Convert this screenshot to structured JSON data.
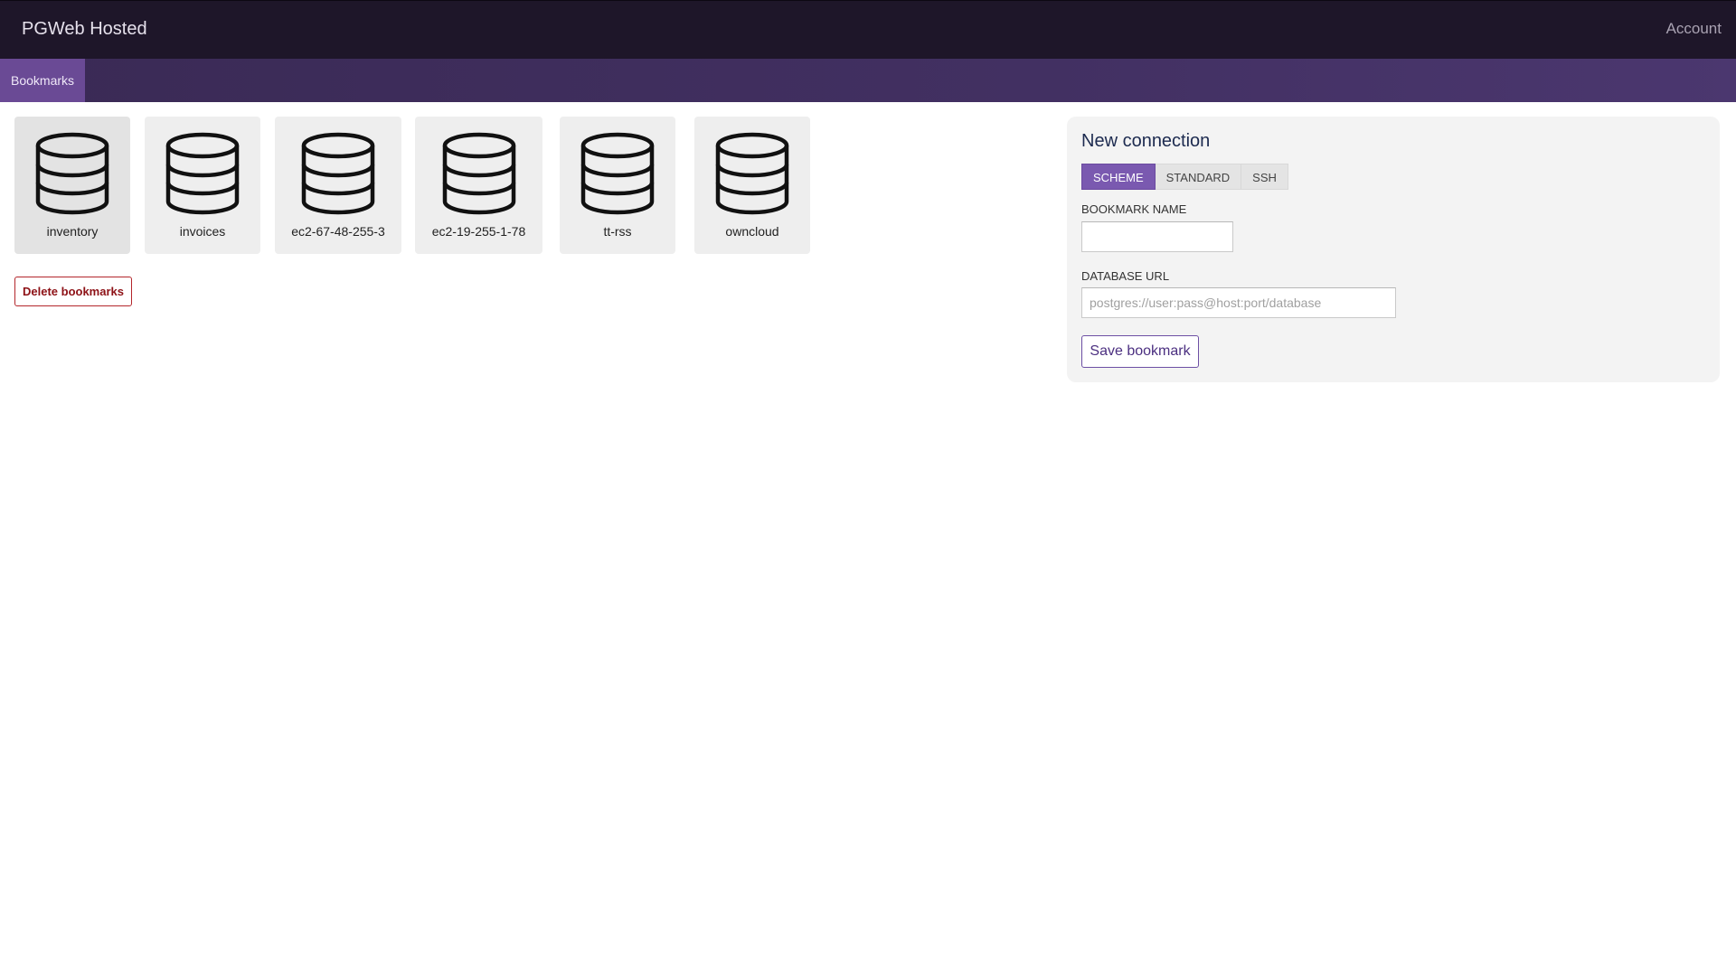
{
  "app": {
    "title": "PGWeb Hosted",
    "account_label": "Account"
  },
  "nav": {
    "tabs": [
      {
        "label": "Bookmarks",
        "active": true
      }
    ]
  },
  "bookmarks": {
    "items": [
      {
        "name": "inventory",
        "icon": "database-icon",
        "selected": true
      },
      {
        "name": "invoices",
        "icon": "database-icon",
        "selected": false
      },
      {
        "name": "ec2-67-48-255-3",
        "icon": "database-icon",
        "selected": false
      },
      {
        "name": "ec2-19-255-1-78",
        "icon": "database-icon",
        "selected": false
      },
      {
        "name": "tt-rss",
        "icon": "database-icon",
        "selected": false
      },
      {
        "name": "owncloud",
        "icon": "database-icon",
        "selected": false
      }
    ],
    "delete_label": "Delete bookmarks"
  },
  "connection": {
    "title": "New connection",
    "tabs": [
      {
        "label": "SCHEME",
        "selected": true
      },
      {
        "label": "STANDARD",
        "selected": false
      },
      {
        "label": "SSH",
        "selected": false
      }
    ],
    "bookmark_name_label": "BOOKMARK NAME",
    "bookmark_name_value": "",
    "database_url_label": "DATABASE URL",
    "database_url_value": "",
    "database_url_placeholder": "postgres://user:pass@host:port/database",
    "save_label": "Save bookmark"
  },
  "colors": {
    "topbar": "#1e1629",
    "navbar": "#3a2a55",
    "accent": "#7a59b0",
    "danger": "#8d1116"
  }
}
